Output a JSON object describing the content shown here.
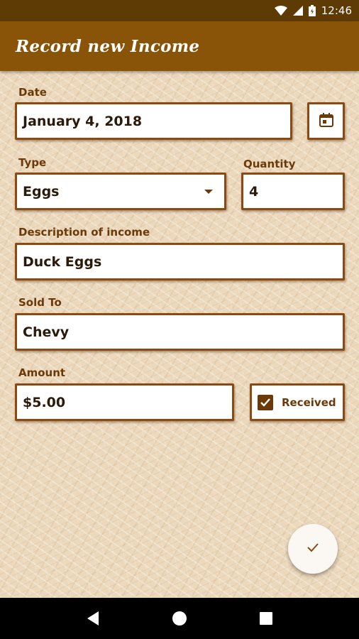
{
  "status_bar": {
    "time": "12:46",
    "icons": [
      "wifi-icon",
      "signal-icon",
      "battery-icon"
    ]
  },
  "app_bar": {
    "title": "Record new Income"
  },
  "form": {
    "date": {
      "label": "Date",
      "value": "January 4, 2018",
      "calendar_icon": "calendar-icon"
    },
    "type": {
      "label": "Type",
      "value": "Eggs"
    },
    "quantity": {
      "label": "Quantity",
      "value": "4"
    },
    "description": {
      "label": "Description of income",
      "value": "Duck Eggs"
    },
    "sold_to": {
      "label": "Sold To",
      "value": "Chevy"
    },
    "amount": {
      "label": "Amount",
      "value": "$5.00"
    },
    "received": {
      "label": "Received",
      "checked": true
    }
  },
  "fab": {
    "icon": "check-icon"
  },
  "nav_bar": {
    "icons": [
      "back-icon",
      "home-icon",
      "recents-icon"
    ]
  },
  "colors": {
    "status_bar": "#5e3a05",
    "app_bar": "#8a5408",
    "accent": "#6b3a08",
    "field_border": "#8b4a12"
  }
}
